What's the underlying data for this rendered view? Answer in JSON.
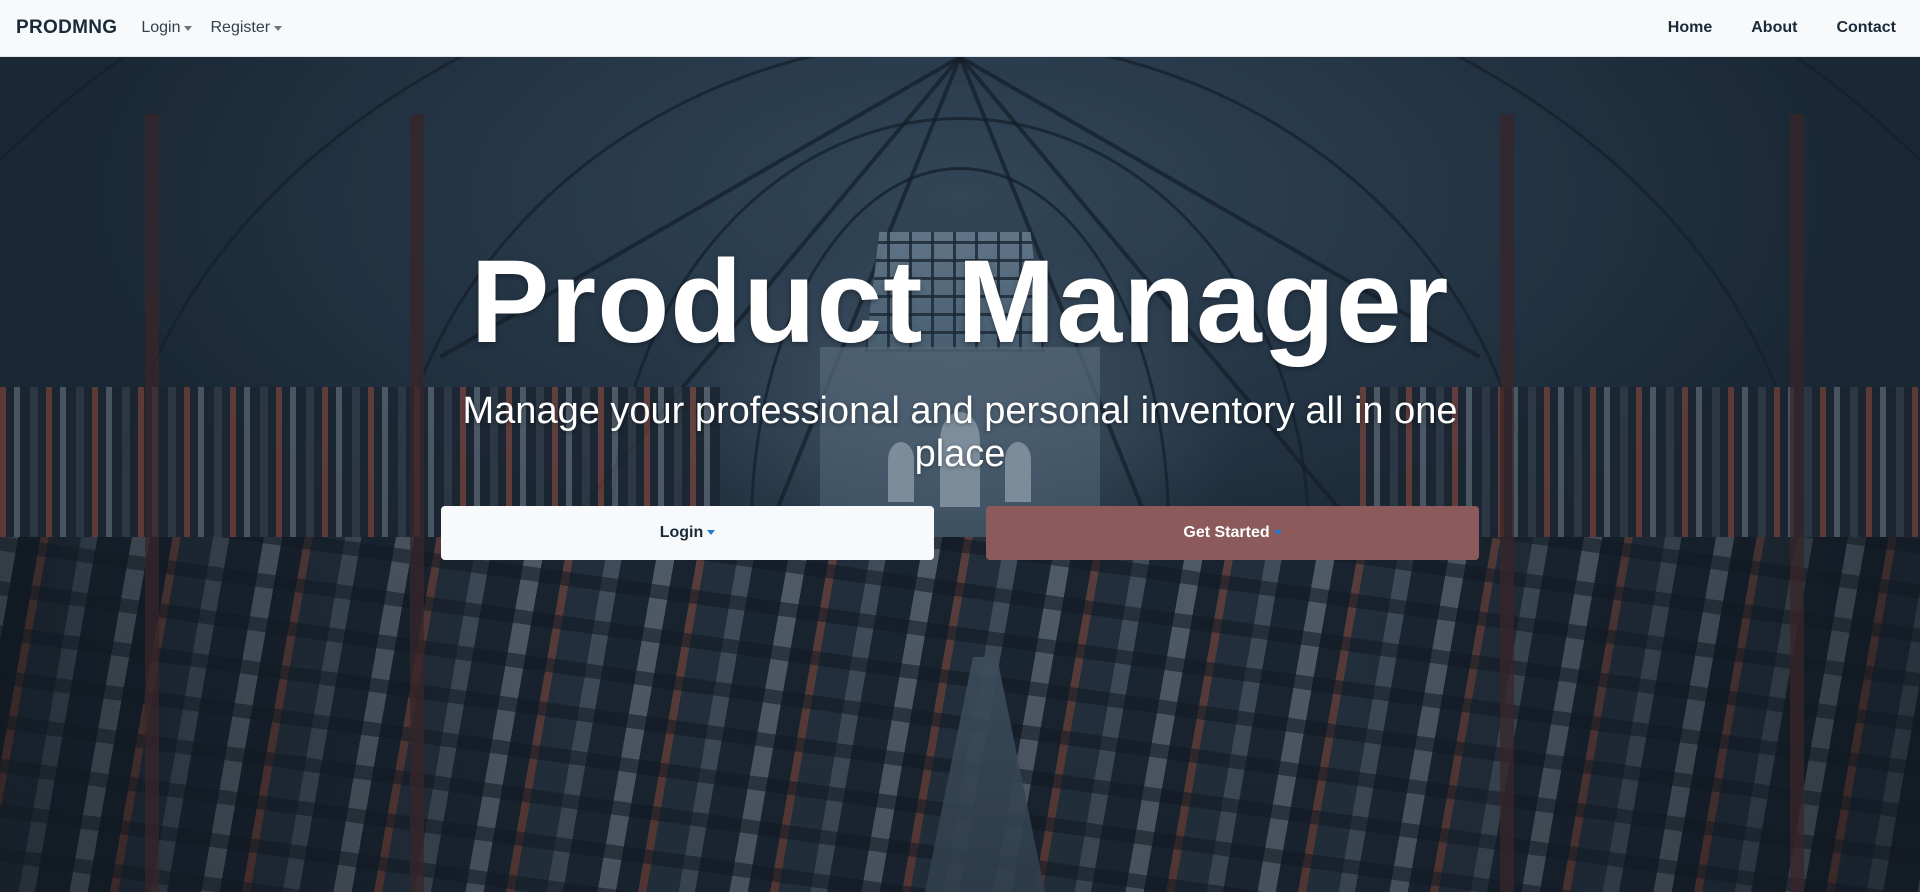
{
  "navbar": {
    "brand": "PRODMNG",
    "left_dropdowns": [
      {
        "label": "Login"
      },
      {
        "label": "Register"
      }
    ],
    "right_links": [
      {
        "label": "Home"
      },
      {
        "label": "About"
      },
      {
        "label": "Contact"
      }
    ]
  },
  "hero": {
    "title": "Product Manager",
    "subtitle": "Manage your professional and personal inventory all in one place",
    "buttons": {
      "login_label": "Login",
      "get_started_label": "Get Started"
    }
  },
  "colors": {
    "navbar_bg": "#f8f9fa",
    "brand_text": "#1b2a38",
    "primary_button": "#8c5a5a",
    "light_button": "#f8f9fa",
    "caret_accent": "#1f7bd3"
  }
}
